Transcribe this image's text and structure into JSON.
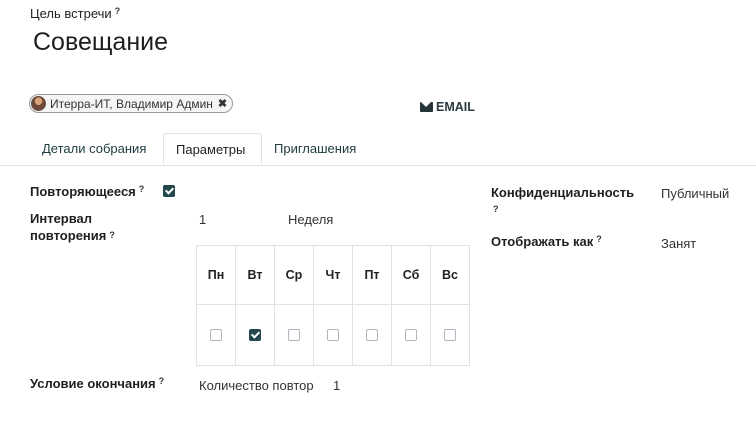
{
  "form": {
    "goal_label": "Цель встречи",
    "help_mark": "?",
    "title": "Совещание",
    "attendee": "Итерра-ИТ, Владимир Админ",
    "email_label": "EMAIL"
  },
  "tabs": [
    {
      "label": "Детали собрания"
    },
    {
      "label": "Параметры"
    },
    {
      "label": "Приглашения"
    }
  ],
  "params": {
    "recurring_label": "Повторяющееся",
    "recurring_checked": true,
    "interval_label_line1": "Интервал",
    "interval_label_line2": "повторения",
    "interval_value": "1",
    "interval_unit": "Неделя",
    "end_label": "Условие окончания",
    "end_type": "Количество повтор",
    "end_count": "1",
    "privacy_label": "Конфиденциальность",
    "privacy_value": "Публичный",
    "show_as_label": "Отображать как",
    "show_as_value": "Занят"
  },
  "weekdays": [
    {
      "label": "Пн",
      "checked": false
    },
    {
      "label": "Вт",
      "checked": true
    },
    {
      "label": "Ср",
      "checked": false
    },
    {
      "label": "Чт",
      "checked": false
    },
    {
      "label": "Пт",
      "checked": false
    },
    {
      "label": "Сб",
      "checked": false
    },
    {
      "label": "Вс",
      "checked": false
    }
  ]
}
